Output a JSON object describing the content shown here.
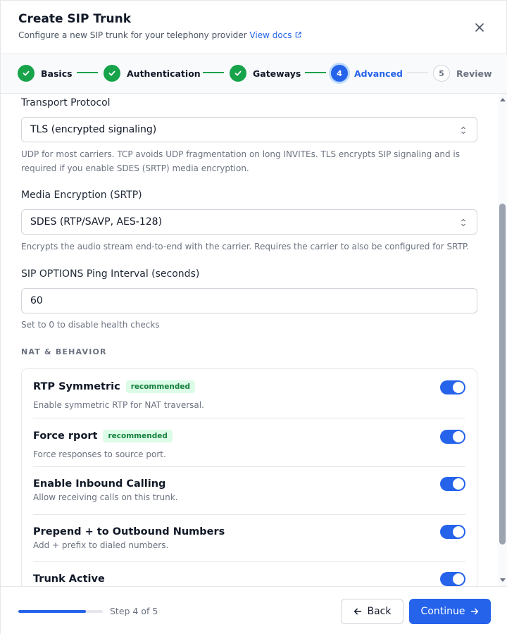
{
  "header": {
    "title": "Create SIP Trunk",
    "subtitle": "Configure a new SIP trunk for your telephony provider",
    "docs_link": "View docs"
  },
  "stepper": {
    "steps": [
      {
        "label": "Basics",
        "state": "done",
        "number": "1"
      },
      {
        "label": "Authentication",
        "state": "done",
        "number": "2"
      },
      {
        "label": "Gateways",
        "state": "done",
        "number": "3"
      },
      {
        "label": "Advanced",
        "state": "active",
        "number": "4"
      },
      {
        "label": "Review",
        "state": "pending",
        "number": "5"
      }
    ]
  },
  "form": {
    "transport": {
      "label": "Transport Protocol",
      "value": "TLS (encrypted signaling)",
      "help": "UDP for most carriers. TCP avoids UDP fragmentation on long INVITEs. TLS encrypts SIP signaling and is required if you enable SDES (SRTP) media encryption."
    },
    "encryption": {
      "label": "Media Encryption (SRTP)",
      "value": "SDES (RTP/SAVP, AES-128)",
      "help": "Encrypts the audio stream end-to-end with the carrier. Requires the carrier to also be configured for SRTP."
    },
    "ping": {
      "label": "SIP OPTIONS Ping Interval (seconds)",
      "value": "60",
      "help": "Set to 0 to disable health checks"
    },
    "nat_section": {
      "heading": "NAT & BEHAVIOR",
      "items": [
        {
          "title": "RTP Symmetric",
          "badge": "recommended",
          "desc": "Enable symmetric RTP for NAT traversal.",
          "enabled": true
        },
        {
          "title": "Force rport",
          "badge": "recommended",
          "desc": "Force responses to source port.",
          "enabled": true
        },
        {
          "title": "Enable Inbound Calling",
          "badge": "",
          "desc": "Allow receiving calls on this trunk.",
          "enabled": true
        },
        {
          "title": "Prepend + to Outbound Numbers",
          "badge": "",
          "desc": "Add + prefix to dialed numbers.",
          "enabled": true
        },
        {
          "title": "Trunk Active",
          "badge": "",
          "desc": "",
          "enabled": true
        }
      ]
    }
  },
  "footer": {
    "progress_fraction": 0.8,
    "step_text": "Step 4 of 5",
    "back_label": "Back",
    "continue_label": "Continue"
  },
  "colors": {
    "accent": "#2563eb",
    "success": "#16a34a",
    "badge_bg": "#dcfce7",
    "badge_text": "#15803d"
  }
}
